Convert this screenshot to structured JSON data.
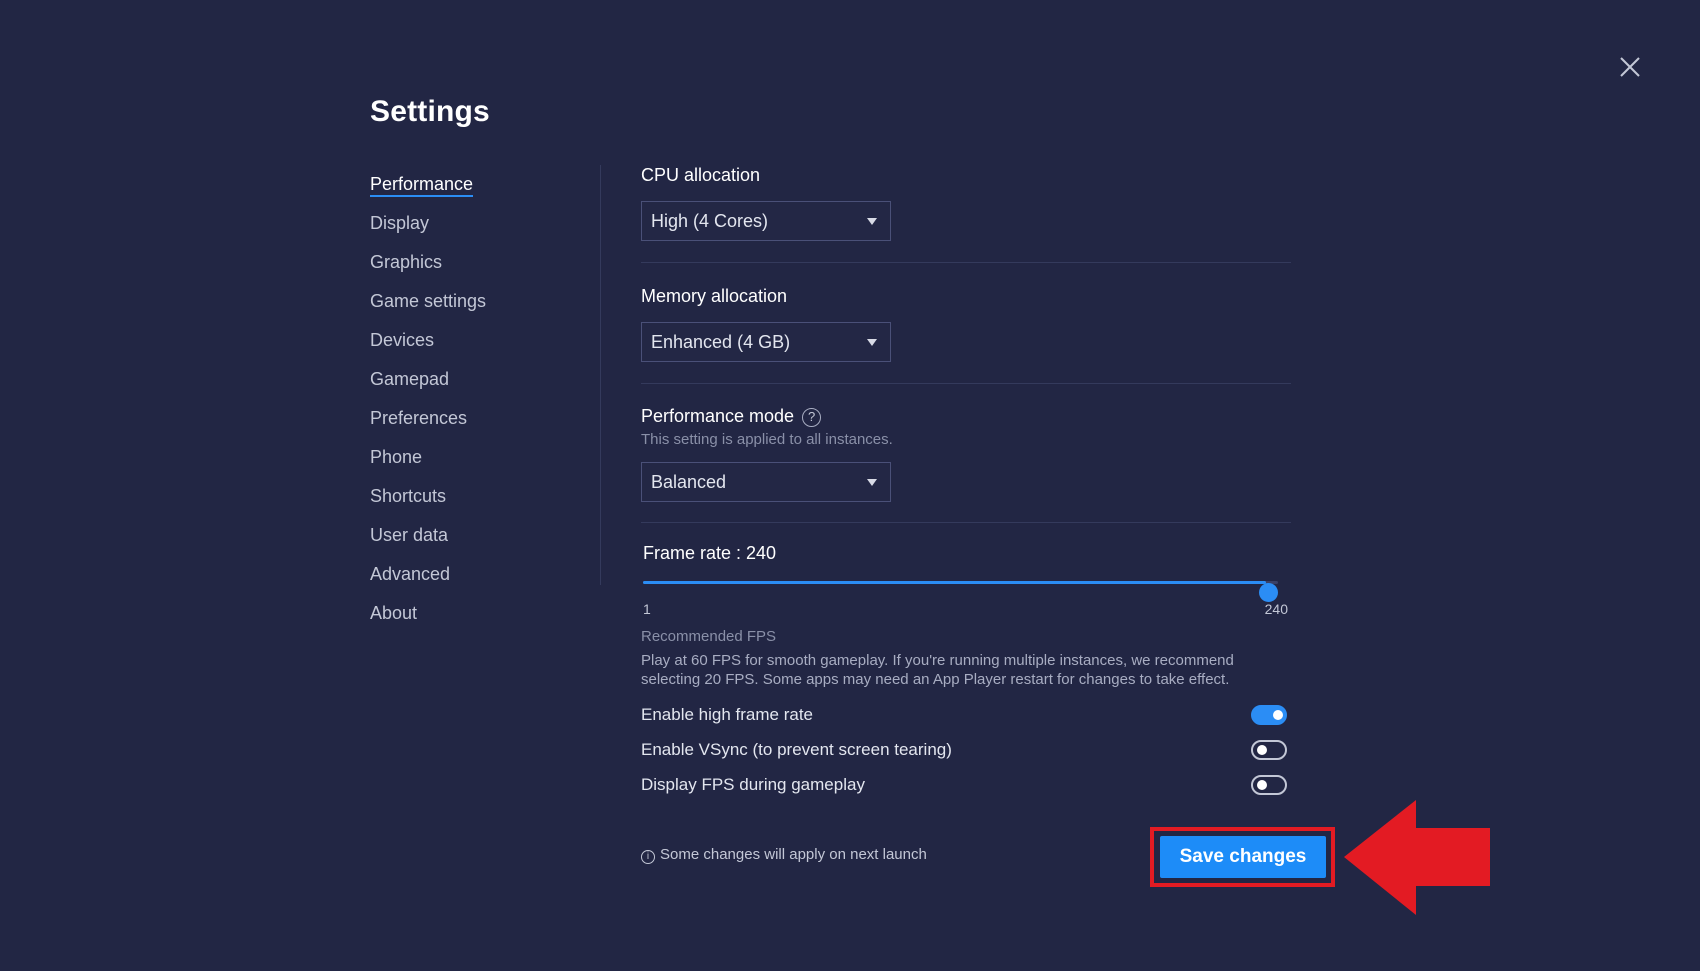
{
  "title": "Settings",
  "sidebar": {
    "items": [
      {
        "label": "Performance",
        "active": true
      },
      {
        "label": "Display"
      },
      {
        "label": "Graphics"
      },
      {
        "label": "Game settings"
      },
      {
        "label": "Devices"
      },
      {
        "label": "Gamepad"
      },
      {
        "label": "Preferences"
      },
      {
        "label": "Phone"
      },
      {
        "label": "Shortcuts"
      },
      {
        "label": "User data"
      },
      {
        "label": "Advanced"
      },
      {
        "label": "About"
      }
    ]
  },
  "cpu": {
    "label": "CPU allocation",
    "value": "High (4 Cores)"
  },
  "memory": {
    "label": "Memory allocation",
    "value": "Enhanced (4 GB)"
  },
  "perf_mode": {
    "label": "Performance mode",
    "help": "?",
    "note": "This setting is applied to all instances.",
    "value": "Balanced"
  },
  "frame_rate": {
    "label": "Frame rate : 240",
    "value": 240,
    "min": 1,
    "max": 240,
    "min_label": "1",
    "max_label": "240"
  },
  "recommended": {
    "title": "Recommended FPS",
    "text": "Play at 60 FPS for smooth gameplay. If you're running multiple instances, we recommend selecting 20 FPS. Some apps may need an App Player restart for changes to take effect."
  },
  "toggles": [
    {
      "label": "Enable high frame rate",
      "on": true
    },
    {
      "label": "Enable VSync (to prevent screen tearing)",
      "on": false
    },
    {
      "label": "Display FPS during gameplay",
      "on": false
    }
  ],
  "footer": {
    "info_glyph": "i",
    "note": "Some changes will apply on next launch",
    "save_label": "Save changes"
  },
  "colors": {
    "background": "#222644",
    "accent": "#2b8df5",
    "highlight": "#e31b23"
  }
}
